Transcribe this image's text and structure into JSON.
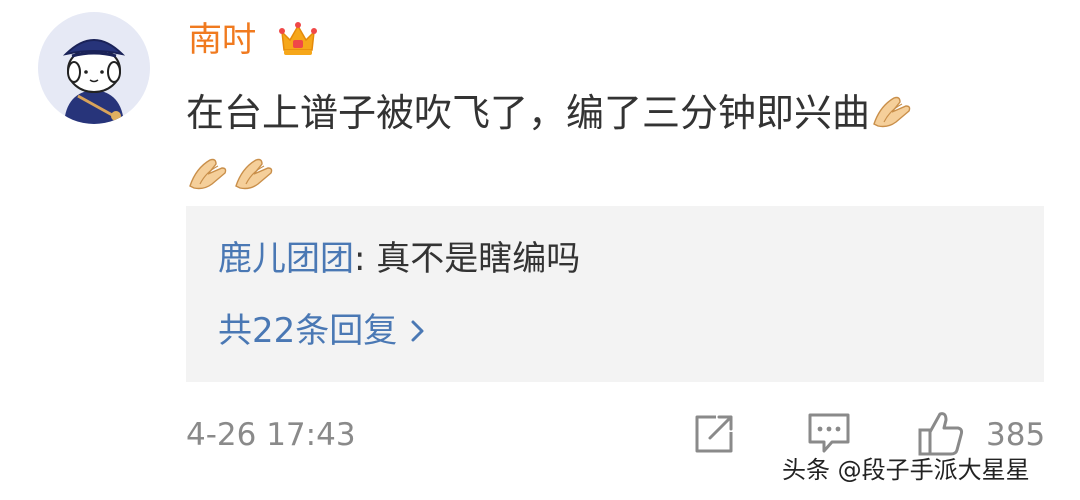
{
  "comment": {
    "user": "南吋",
    "text": "在台上谱子被吹飞了，编了三分钟即兴曲",
    "emoji_icon": "clap-hands-icon",
    "emoji_count": 3
  },
  "reply": {
    "user": "鹿儿团团",
    "separator": ": ",
    "text": "真不是瞎编吗",
    "more_label": "共22条回复"
  },
  "footer": {
    "timestamp": "4-26 17:43",
    "like_count": "385"
  },
  "watermark": "头条 @段子手派大星星",
  "colors": {
    "username": "#f07a1f",
    "link": "#4a78b4",
    "reply_bg": "#f3f3f3",
    "meta": "#8a8a8a"
  }
}
